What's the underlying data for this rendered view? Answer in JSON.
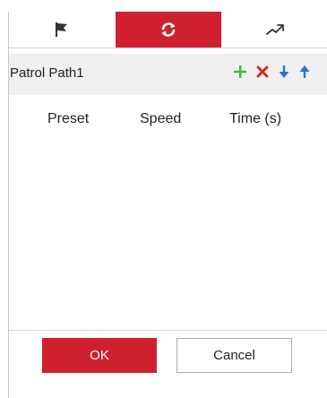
{
  "tabs": [
    {
      "icon": "flag-icon",
      "active": false
    },
    {
      "icon": "refresh-cycle-icon",
      "active": true
    },
    {
      "icon": "trend-icon",
      "active": false
    }
  ],
  "patrol": {
    "title": "Patrol Path1",
    "actions": [
      {
        "icon": "add-icon",
        "color": "#3cb44b"
      },
      {
        "icon": "delete-icon",
        "color": "#e02020"
      },
      {
        "icon": "move-down-icon",
        "color": "#2f6fd6"
      },
      {
        "icon": "move-up-icon",
        "color": "#2f6fd6"
      }
    ]
  },
  "table": {
    "columns": [
      "Preset",
      "Speed",
      "Time (s)"
    ],
    "rows": []
  },
  "buttons": {
    "ok": "OK",
    "cancel": "Cancel"
  },
  "colors": {
    "accent": "#cf202f",
    "header_bg": "#efefef"
  }
}
